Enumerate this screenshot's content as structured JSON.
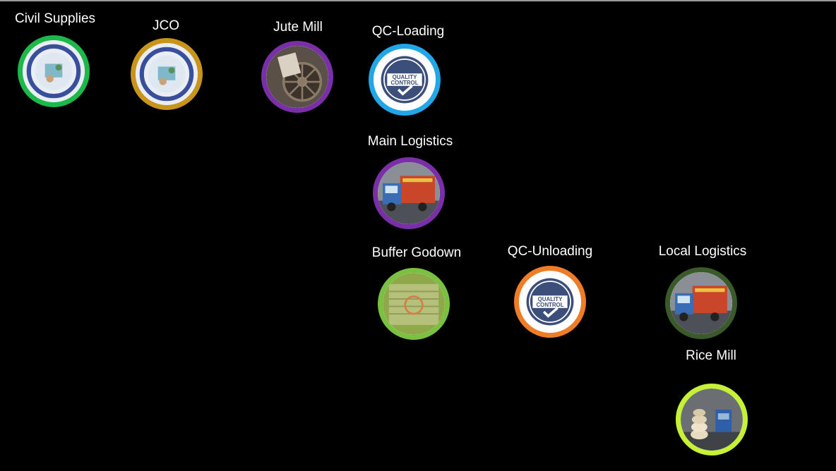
{
  "nodes": [
    {
      "id": "civil-supplies",
      "label": "Civil Supplies",
      "icon": "civil-supplies-seal-icon",
      "ring": "#1db84a"
    },
    {
      "id": "jco",
      "label": "JCO",
      "icon": "civil-supplies-seal-icon",
      "ring": "#c8941a"
    },
    {
      "id": "jute-mill",
      "label": "Jute Mill",
      "icon": "jute-mill-machine-icon",
      "ring": "#7a2fa8"
    },
    {
      "id": "qc-loading",
      "label": "QC-Loading",
      "icon": "quality-control-badge-icon",
      "ring": "#21a6e8"
    },
    {
      "id": "main-logistics",
      "label": "Main Logistics",
      "icon": "truck-icon",
      "ring": "#7a2fa8"
    },
    {
      "id": "buffer-godown",
      "label": "Buffer Godown",
      "icon": "warehouse-icon",
      "ring": "#7ac142"
    },
    {
      "id": "qc-unloading",
      "label": "QC-Unloading",
      "icon": "quality-control-badge-icon",
      "ring": "#ef7d27"
    },
    {
      "id": "local-logistics",
      "label": "Local Logistics",
      "icon": "truck-icon",
      "ring": "#3a5a2a"
    },
    {
      "id": "rice-mill",
      "label": "Rice Mill",
      "icon": "rice-bags-icon",
      "ring": "#c6f135"
    }
  ],
  "badge_text": {
    "line1": "QUALITY",
    "line2": "CONTROL"
  }
}
